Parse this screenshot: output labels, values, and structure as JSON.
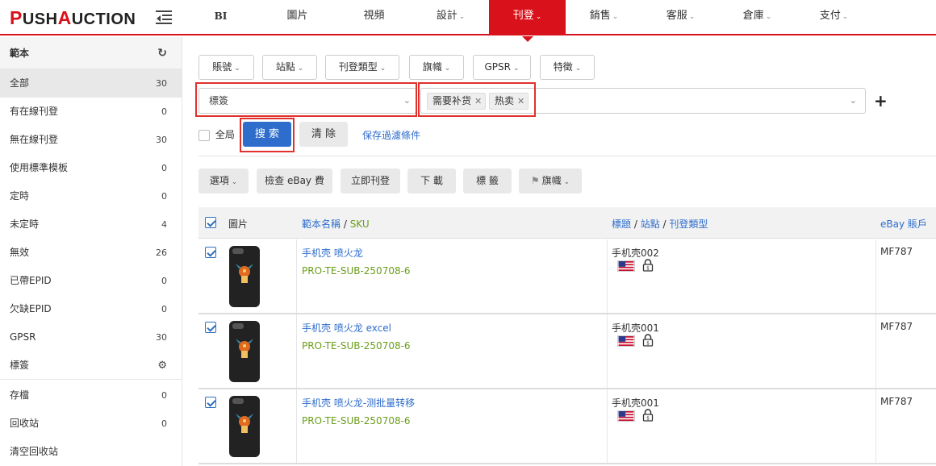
{
  "logo": {
    "first_letter_1": "P",
    "rest_1": "USH",
    "first_letter_2": "A",
    "rest_2": "UCTION"
  },
  "nav": {
    "items": [
      {
        "label": "BI",
        "caret": false
      },
      {
        "label": "圖片",
        "caret": false
      },
      {
        "label": "視頻",
        "caret": false
      },
      {
        "label": "設計",
        "caret": true
      },
      {
        "label": "刊登",
        "caret": true,
        "active": true
      },
      {
        "label": "銷售",
        "caret": true
      },
      {
        "label": "客服",
        "caret": true
      },
      {
        "label": "倉庫",
        "caret": true
      },
      {
        "label": "支付",
        "caret": true
      }
    ]
  },
  "sidebar": {
    "header": "範本",
    "items": [
      {
        "label": "全部",
        "count": "30",
        "active": true
      },
      {
        "label": "有在線刊登",
        "count": "0"
      },
      {
        "label": "無在線刊登",
        "count": "30"
      },
      {
        "label": "使用標準模板",
        "count": "0"
      },
      {
        "label": "定時",
        "count": "0"
      },
      {
        "label": "未定時",
        "count": "4"
      },
      {
        "label": "無效",
        "count": "26"
      },
      {
        "label": "已帶EPID",
        "count": "0"
      },
      {
        "label": "欠缺EPID",
        "count": "0"
      },
      {
        "label": "GPSR",
        "count": "30"
      },
      {
        "label": "標簽",
        "count": ""
      },
      {
        "label": "存檔",
        "count": "0"
      },
      {
        "label": "回收站",
        "count": "0"
      },
      {
        "label": "清空回收站",
        "count": ""
      }
    ]
  },
  "filters": {
    "buttons": [
      "賬號",
      "站點",
      "刊登類型",
      "旗幟",
      "GPSR",
      "特徵"
    ],
    "label_select_placeholder": "標簽",
    "tags": [
      "需要补货",
      "热卖"
    ],
    "global_label": "全局",
    "search_label": "搜 索",
    "clear_label": "清 除",
    "save_filter_label": "保存過濾條件"
  },
  "actions": {
    "options": "選項",
    "check_fee": "檢查 eBay 費",
    "list_now": "立即刊登",
    "download": "下 載",
    "tag": "標 籤",
    "flag": "旗幟"
  },
  "table": {
    "col_image": "圖片",
    "col_name": "範本名稱",
    "col_sku": "SKU",
    "col_title": "標題",
    "col_site": "站點",
    "col_type": "刊登類型",
    "col_account": "eBay 賬戶",
    "separator": " / ",
    "rows": [
      {
        "name": "手机壳 喷火龙",
        "sku": "PRO-TE-SUB-250708-6",
        "title": "手机壳002",
        "account": "MF787"
      },
      {
        "name": "手机壳 喷火龙 excel",
        "sku": "PRO-TE-SUB-250708-6",
        "title": "手机壳001",
        "account": "MF787"
      },
      {
        "name": "手机壳 喷火龙-测批量转移",
        "sku": "PRO-TE-SUB-250708-6",
        "title": "手机壳001",
        "account": "MF787"
      }
    ]
  },
  "colors": {
    "brand_red": "#d9111a",
    "primary_blue": "#2e6dcc",
    "sku_green": "#6a9d1a",
    "highlight_red": "#e0312d"
  }
}
